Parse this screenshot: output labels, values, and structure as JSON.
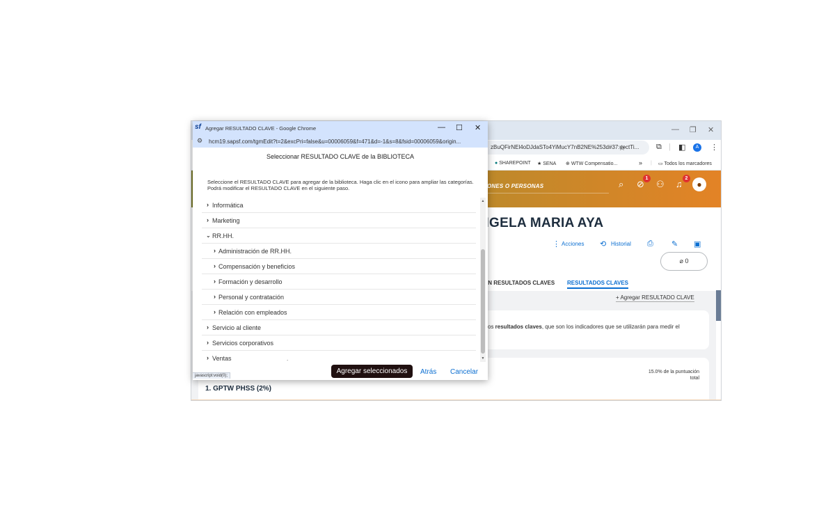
{
  "background_window": {
    "address_text": "zBuQFirNEl4oDJdaSTo4YiMucY7nB2NE%253d#37:sectTi...",
    "bookmarks": [
      {
        "icon": "sharepoint-icon",
        "label": "SHAREPOINT"
      },
      {
        "icon": "star-icon",
        "label": "SENA"
      },
      {
        "icon": "globe-icon",
        "label": "WTW Compensatio..."
      }
    ],
    "bookmarks_overflow": "»",
    "all_bookmarks": "Todos los marcadores",
    "search_placeholder": "ONES O PERSONAS",
    "notification_badges": [
      "1",
      "2"
    ],
    "person_name": "NGELA MARIA AYA",
    "actions": {
      "acciones": "Acciones",
      "historial": "Historial"
    },
    "attachments_count": "0",
    "tabs": [
      "ÓN RESULTADOS CLAVES",
      "RESULTADOS CLAVES"
    ],
    "add_key_result": "Agregar RESULTADO CLAVE",
    "description_prefix": "os ",
    "description_bold": "resultados claves",
    "description_suffix": ", que son los indicadores que se utilizarán para medir el",
    "weight_line1": "15.0% de la puntuación",
    "weight_line2": "total",
    "goal_title": "1. GPTW PHSS (2%)"
  },
  "popup": {
    "window_title": "Agregar RESULTADO CLAVE - Google Chrome",
    "url": "hcm19.sapsf.com/tgmEdit?t=2&excPri=false&u=00006059&f=471&d=-1&s=8&fsid=00006059&origin...",
    "heading": "Seleccionar RESULTADO CLAVE de la BIBLIOTECA",
    "instructions": "Seleccione el RESULTADO CLAVE para agregar de la biblioteca. Haga clic en el icono para ampliar las categorías. Podrá modificar el RESULTADO CLAVE en el siguiente paso.",
    "categories": [
      {
        "label": "Informática",
        "level": 0,
        "expanded": false
      },
      {
        "label": "Marketing",
        "level": 0,
        "expanded": false
      },
      {
        "label": "RR.HH.",
        "level": 0,
        "expanded": true
      },
      {
        "label": "Administración de RR.HH.",
        "level": 1,
        "expanded": false
      },
      {
        "label": "Compensación y beneficios",
        "level": 1,
        "expanded": false
      },
      {
        "label": "Formación y desarrollo",
        "level": 1,
        "expanded": false
      },
      {
        "label": "Personal y contratación",
        "level": 1,
        "expanded": false
      },
      {
        "label": "Relación con empleados",
        "level": 1,
        "expanded": false
      },
      {
        "label": "Servicio al cliente",
        "level": 0,
        "expanded": false
      },
      {
        "label": "Servicios corporativos",
        "level": 0,
        "expanded": false
      },
      {
        "label": "Ventas",
        "level": 0,
        "expanded": false
      }
    ],
    "buttons": {
      "add_selected": "Agregar seleccionados",
      "back": "Atrás",
      "cancel": "Cancelar"
    },
    "status_bar": "javascript:void(0);"
  },
  "colors": {
    "accent": "#0a6ed1",
    "primary_button": "#201010",
    "chrome_frame": "#d3e3fd"
  }
}
